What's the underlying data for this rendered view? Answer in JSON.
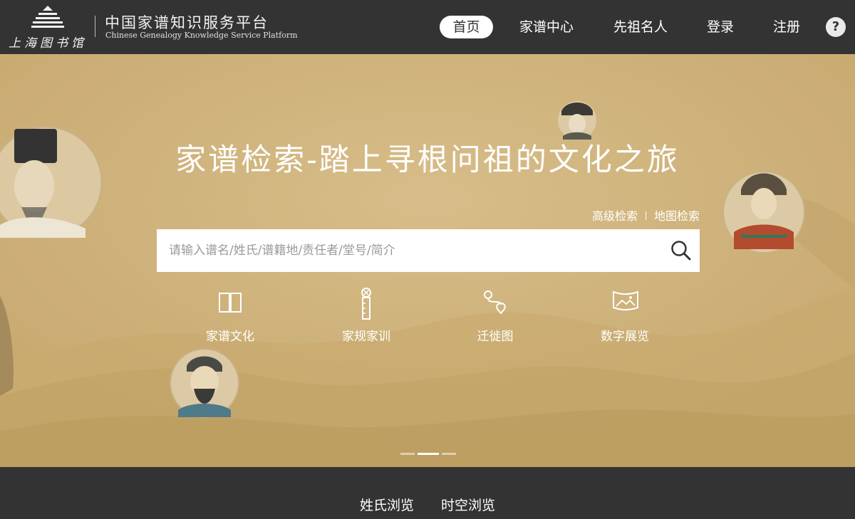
{
  "header": {
    "logo_text": "上海图书馆",
    "platform_name_cn": "中国家谱知识服务平台",
    "platform_name_en": "Chinese Genealogy Knowledge Service Platform",
    "nav": [
      {
        "label": "首页",
        "active": true
      },
      {
        "label": "家谱中心",
        "active": false
      },
      {
        "label": "先祖名人",
        "active": false
      },
      {
        "label": "登录",
        "active": false
      },
      {
        "label": "注册",
        "active": false
      }
    ],
    "help_label": "?"
  },
  "hero": {
    "title": "家谱检索-踏上寻根问祖的文化之旅",
    "advanced_search": "高级检索",
    "map_search": "地图检索",
    "search_placeholder": "请输入谱名/姓氏/谱籍地/责任者/堂号/简介",
    "features": [
      {
        "label": "家谱文化",
        "icon": "book-icon"
      },
      {
        "label": "家规家训",
        "icon": "scroll-icon"
      },
      {
        "label": "迁徙图",
        "icon": "route-icon"
      },
      {
        "label": "数字展览",
        "icon": "exhibition-icon"
      }
    ],
    "carousel": {
      "count": 3,
      "active_index": 1
    }
  },
  "bottom_tabs": [
    {
      "label": "姓氏浏览"
    },
    {
      "label": "时空浏览"
    }
  ],
  "colors": {
    "header_bg": "#333333",
    "hero_bg": "#cfb27a",
    "text_light": "#ffffff"
  }
}
